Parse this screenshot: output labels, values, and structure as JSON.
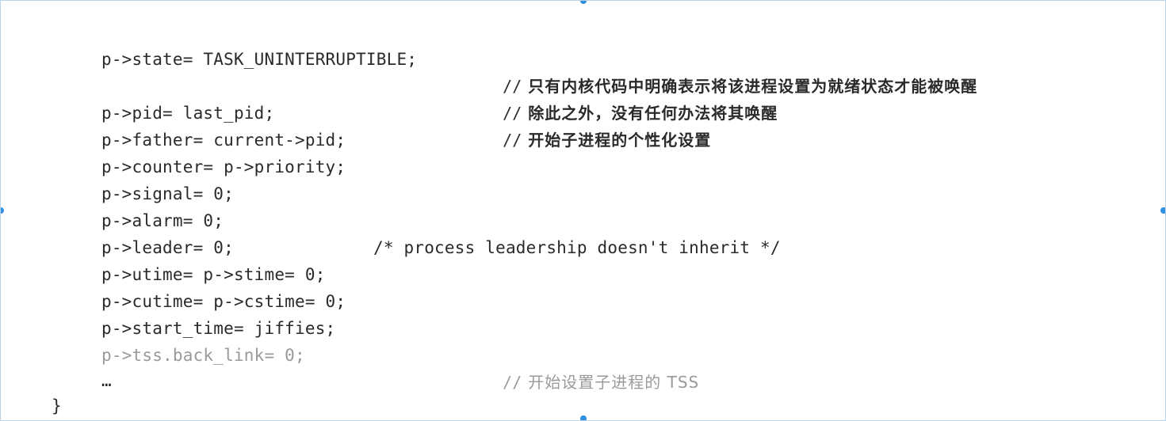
{
  "code": {
    "lines": [
      "p->state= TASK_UNINTERRUPTIBLE;",
      "p->pid= last_pid;",
      "p->father= current->pid;",
      "p->counter= p->priority;",
      "p->signal= 0;",
      "p->alarm= 0;",
      "p->leader= 0;",
      "p->utime= p->stime= 0;",
      "p->cutime= p->cstime= 0;",
      "p->start_time= jiffies;",
      "p->tss.back_link= 0;",
      "…"
    ],
    "leader_comment": "/* process leadership doesn't inherit */",
    "comments": {
      "slashes": "//",
      "state_line1": "只有内核代码中明确表示将该进程设置为就绪状态才能被唤醒",
      "state_line2": "除此之外，没有任何办法将其唤醒",
      "pid": "开始子进程的个性化设置",
      "tss": "开始设置子进程的 TSS"
    },
    "closing_brace": "}"
  }
}
